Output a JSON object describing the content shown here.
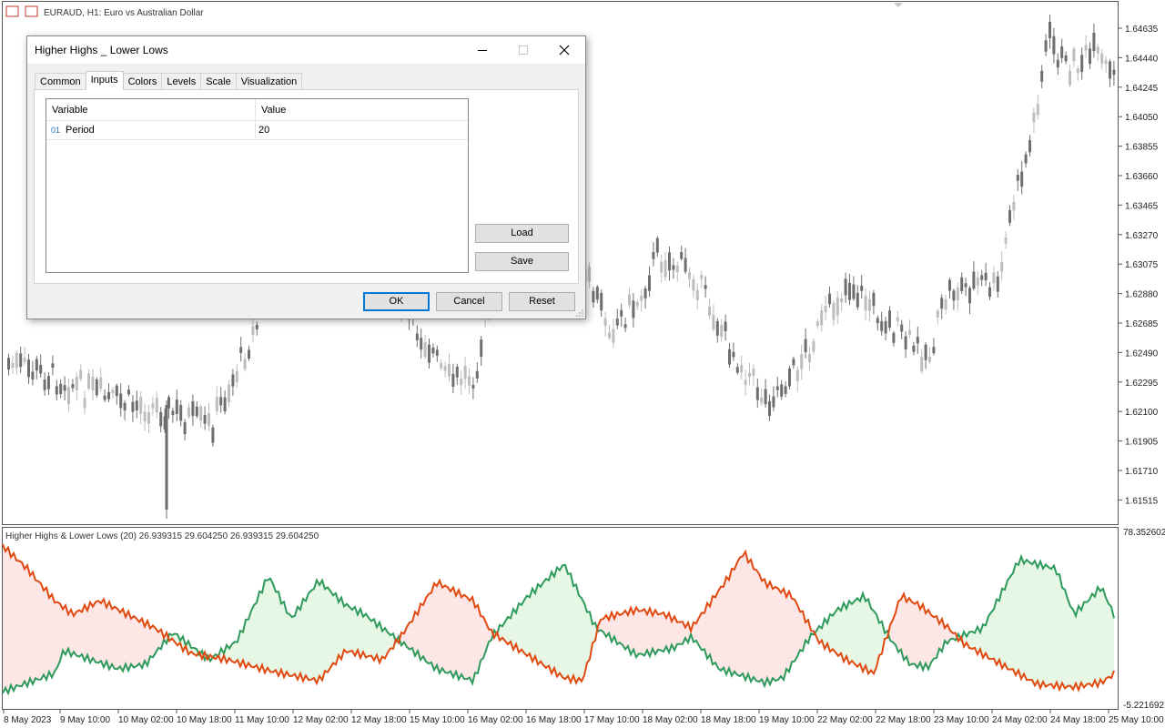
{
  "chart": {
    "header": "EURAUD, H1:  Euro vs Australian Dollar",
    "price_ticks": [
      "1.64635",
      "1.64440",
      "1.64245",
      "1.64050",
      "1.63855",
      "1.63660",
      "1.63465",
      "1.63270",
      "1.63075",
      "1.62880",
      "1.62685",
      "1.62490",
      "1.62295",
      "1.62100",
      "1.61905",
      "1.61710",
      "1.61515"
    ],
    "indicator_title": "Higher Highs & Lower Lows (20) 26.939315 29.604250 26.939315 29.604250",
    "indicator_max": "78.352602",
    "indicator_min": "-5.221692",
    "time_ticks": [
      "8 May 2023",
      "9 May 10:00",
      "10 May 02:00",
      "10 May 18:00",
      "11 May 10:00",
      "12 May 02:00",
      "12 May 18:00",
      "15 May 10:00",
      "16 May 02:00",
      "16 May 18:00",
      "17 May 10:00",
      "18 May 02:00",
      "18 May 18:00",
      "19 May 10:00",
      "22 May 02:00",
      "22 May 18:00",
      "23 May 10:00",
      "24 May 02:00",
      "24 May 18:00",
      "25 May 10:00"
    ],
    "colors": {
      "bull_candle": "#bdbdbd",
      "bear_candle": "#6e6e6e",
      "higher_highs_line": "#2e9a5c",
      "lower_lows_line": "#e04a10",
      "fill_green": "#e6f7e6",
      "fill_red": "#fde6e6"
    }
  },
  "dialog": {
    "title": "Higher Highs _ Lower Lows",
    "tabs": [
      "Common",
      "Inputs",
      "Colors",
      "Levels",
      "Scale",
      "Visualization"
    ],
    "active_tab": "Inputs",
    "table": {
      "columns": [
        "Variable",
        "Value"
      ],
      "rows": [
        {
          "icon": "01",
          "variable": "Period",
          "value": "20"
        }
      ]
    },
    "buttons": {
      "load": "Load",
      "save": "Save",
      "ok": "OK",
      "cancel": "Cancel",
      "reset": "Reset"
    }
  }
}
